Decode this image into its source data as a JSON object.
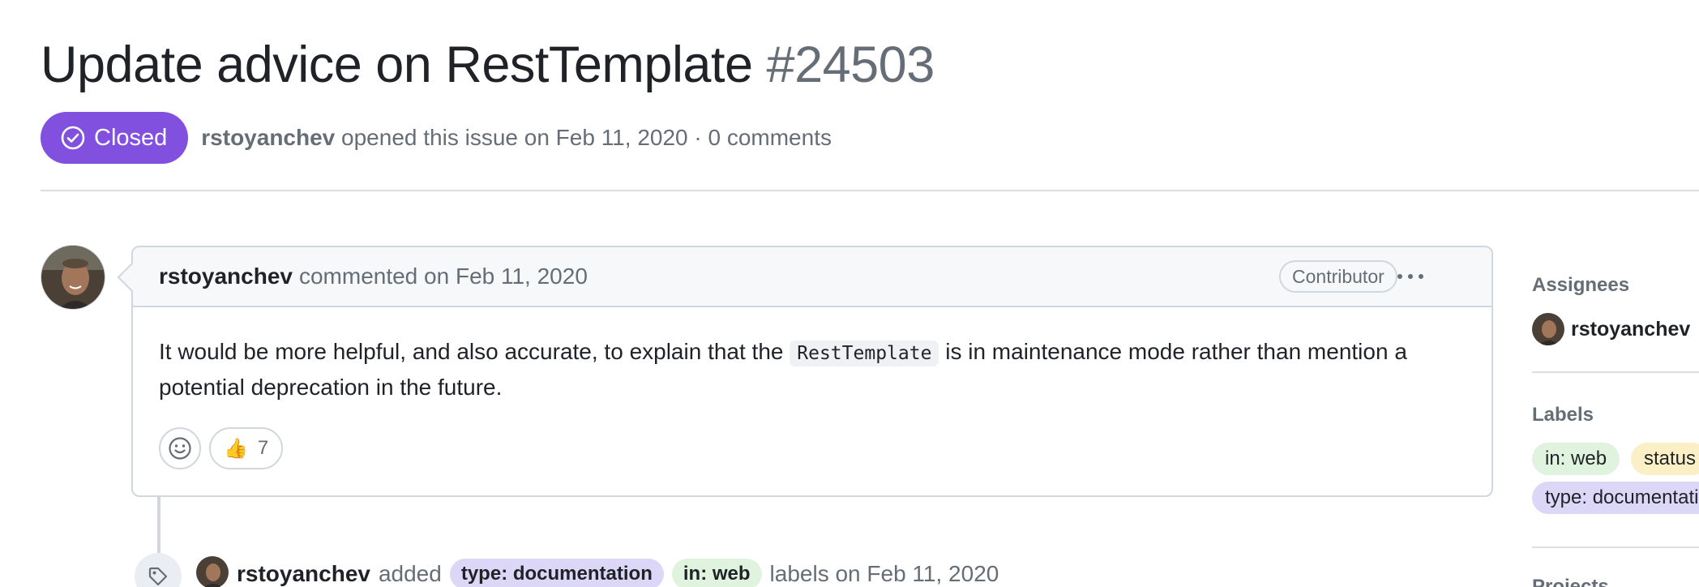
{
  "issue": {
    "title": "Update advice on RestTemplate",
    "number": "#24503",
    "state": "Closed",
    "author": "rstoyanchev",
    "meta_text": "opened this issue on Feb 11, 2020 · 0 comments"
  },
  "comment": {
    "author": "rstoyanchev",
    "action": "commented on Feb 11, 2020",
    "role_badge": "Contributor",
    "body_before": "It would be more helpful, and also accurate, to explain that the",
    "body_code": "RestTemplate",
    "body_after": "is in maintenance mode rather than mention a potential deprecation in the future.",
    "reactions": [
      {
        "emoji": "👍",
        "count": "7"
      }
    ]
  },
  "event": {
    "actor": "rstoyanchev",
    "action": "added",
    "labels": [
      "type: documentation",
      "in: web"
    ],
    "suffix": "labels on Feb 11, 2020"
  },
  "sidebar": {
    "assignees_heading": "Assignees",
    "assignee": "rstoyanchev",
    "labels_heading": "Labels",
    "labels": [
      "in: web",
      "status",
      "type: documentation"
    ],
    "projects_heading": "Projects"
  },
  "colors": {
    "closed_badge": "#8250df",
    "label_purple": "#dcd6f7",
    "label_green": "#dff3de",
    "label_yellow": "#fbefc6"
  }
}
